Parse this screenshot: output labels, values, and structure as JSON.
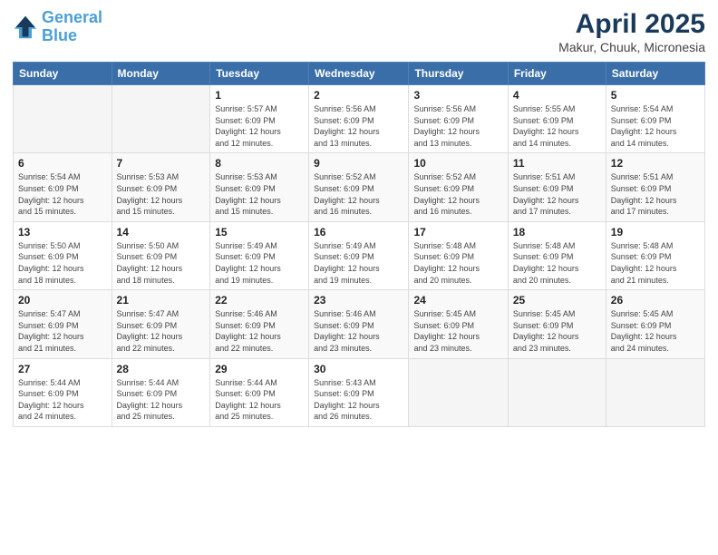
{
  "header": {
    "logo_line1": "General",
    "logo_line2": "Blue",
    "month_title": "April 2025",
    "location": "Makur, Chuuk, Micronesia"
  },
  "weekdays": [
    "Sunday",
    "Monday",
    "Tuesday",
    "Wednesday",
    "Thursday",
    "Friday",
    "Saturday"
  ],
  "weeks": [
    [
      {
        "day": "",
        "info": ""
      },
      {
        "day": "",
        "info": ""
      },
      {
        "day": "1",
        "info": "Sunrise: 5:57 AM\nSunset: 6:09 PM\nDaylight: 12 hours\nand 12 minutes."
      },
      {
        "day": "2",
        "info": "Sunrise: 5:56 AM\nSunset: 6:09 PM\nDaylight: 12 hours\nand 13 minutes."
      },
      {
        "day": "3",
        "info": "Sunrise: 5:56 AM\nSunset: 6:09 PM\nDaylight: 12 hours\nand 13 minutes."
      },
      {
        "day": "4",
        "info": "Sunrise: 5:55 AM\nSunset: 6:09 PM\nDaylight: 12 hours\nand 14 minutes."
      },
      {
        "day": "5",
        "info": "Sunrise: 5:54 AM\nSunset: 6:09 PM\nDaylight: 12 hours\nand 14 minutes."
      }
    ],
    [
      {
        "day": "6",
        "info": "Sunrise: 5:54 AM\nSunset: 6:09 PM\nDaylight: 12 hours\nand 15 minutes."
      },
      {
        "day": "7",
        "info": "Sunrise: 5:53 AM\nSunset: 6:09 PM\nDaylight: 12 hours\nand 15 minutes."
      },
      {
        "day": "8",
        "info": "Sunrise: 5:53 AM\nSunset: 6:09 PM\nDaylight: 12 hours\nand 15 minutes."
      },
      {
        "day": "9",
        "info": "Sunrise: 5:52 AM\nSunset: 6:09 PM\nDaylight: 12 hours\nand 16 minutes."
      },
      {
        "day": "10",
        "info": "Sunrise: 5:52 AM\nSunset: 6:09 PM\nDaylight: 12 hours\nand 16 minutes."
      },
      {
        "day": "11",
        "info": "Sunrise: 5:51 AM\nSunset: 6:09 PM\nDaylight: 12 hours\nand 17 minutes."
      },
      {
        "day": "12",
        "info": "Sunrise: 5:51 AM\nSunset: 6:09 PM\nDaylight: 12 hours\nand 17 minutes."
      }
    ],
    [
      {
        "day": "13",
        "info": "Sunrise: 5:50 AM\nSunset: 6:09 PM\nDaylight: 12 hours\nand 18 minutes."
      },
      {
        "day": "14",
        "info": "Sunrise: 5:50 AM\nSunset: 6:09 PM\nDaylight: 12 hours\nand 18 minutes."
      },
      {
        "day": "15",
        "info": "Sunrise: 5:49 AM\nSunset: 6:09 PM\nDaylight: 12 hours\nand 19 minutes."
      },
      {
        "day": "16",
        "info": "Sunrise: 5:49 AM\nSunset: 6:09 PM\nDaylight: 12 hours\nand 19 minutes."
      },
      {
        "day": "17",
        "info": "Sunrise: 5:48 AM\nSunset: 6:09 PM\nDaylight: 12 hours\nand 20 minutes."
      },
      {
        "day": "18",
        "info": "Sunrise: 5:48 AM\nSunset: 6:09 PM\nDaylight: 12 hours\nand 20 minutes."
      },
      {
        "day": "19",
        "info": "Sunrise: 5:48 AM\nSunset: 6:09 PM\nDaylight: 12 hours\nand 21 minutes."
      }
    ],
    [
      {
        "day": "20",
        "info": "Sunrise: 5:47 AM\nSunset: 6:09 PM\nDaylight: 12 hours\nand 21 minutes."
      },
      {
        "day": "21",
        "info": "Sunrise: 5:47 AM\nSunset: 6:09 PM\nDaylight: 12 hours\nand 22 minutes."
      },
      {
        "day": "22",
        "info": "Sunrise: 5:46 AM\nSunset: 6:09 PM\nDaylight: 12 hours\nand 22 minutes."
      },
      {
        "day": "23",
        "info": "Sunrise: 5:46 AM\nSunset: 6:09 PM\nDaylight: 12 hours\nand 23 minutes."
      },
      {
        "day": "24",
        "info": "Sunrise: 5:45 AM\nSunset: 6:09 PM\nDaylight: 12 hours\nand 23 minutes."
      },
      {
        "day": "25",
        "info": "Sunrise: 5:45 AM\nSunset: 6:09 PM\nDaylight: 12 hours\nand 23 minutes."
      },
      {
        "day": "26",
        "info": "Sunrise: 5:45 AM\nSunset: 6:09 PM\nDaylight: 12 hours\nand 24 minutes."
      }
    ],
    [
      {
        "day": "27",
        "info": "Sunrise: 5:44 AM\nSunset: 6:09 PM\nDaylight: 12 hours\nand 24 minutes."
      },
      {
        "day": "28",
        "info": "Sunrise: 5:44 AM\nSunset: 6:09 PM\nDaylight: 12 hours\nand 25 minutes."
      },
      {
        "day": "29",
        "info": "Sunrise: 5:44 AM\nSunset: 6:09 PM\nDaylight: 12 hours\nand 25 minutes."
      },
      {
        "day": "30",
        "info": "Sunrise: 5:43 AM\nSunset: 6:09 PM\nDaylight: 12 hours\nand 26 minutes."
      },
      {
        "day": "",
        "info": ""
      },
      {
        "day": "",
        "info": ""
      },
      {
        "day": "",
        "info": ""
      }
    ]
  ]
}
